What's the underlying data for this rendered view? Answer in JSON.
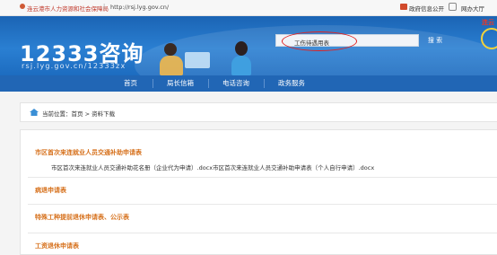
{
  "topbar": {
    "org_name": "连云港市人力资源和社会保障局",
    "separator": "|",
    "url": "http://rsj.lyg.gov.cn/",
    "gov_link": "政府信息公开",
    "hall_link": "网办大厅"
  },
  "banner": {
    "logo_text": "12333咨询",
    "site_url": "rsj.lyg.gov.cn/12333zx",
    "corner_badge": "连云"
  },
  "search": {
    "value": "工伤待遇用表",
    "button_label": "搜 索"
  },
  "nav": {
    "items": [
      "首页",
      "局长信箱",
      "电话咨询",
      "政务服务"
    ]
  },
  "breadcrumb": {
    "text": "当前位置：首页 > 资料下载"
  },
  "categories": [
    {
      "title": "市区首次来连就业人员交通补助申请表",
      "files": "市区首次来连就业人员交通补助花名册（企业代为申请）.docx市区首次来连就业人员交通补助申请表（个人自行申请）.docx"
    },
    {
      "title": "病退申请表"
    },
    {
      "title": "特殊工种提前退休申请表、公示表"
    },
    {
      "title": "工资退休申请表"
    }
  ],
  "colors": {
    "banner_blue": "#2a7fd2",
    "nav_blue": "#2166b5",
    "category_orange": "#d6701b",
    "highlight_red": "#e02222"
  }
}
